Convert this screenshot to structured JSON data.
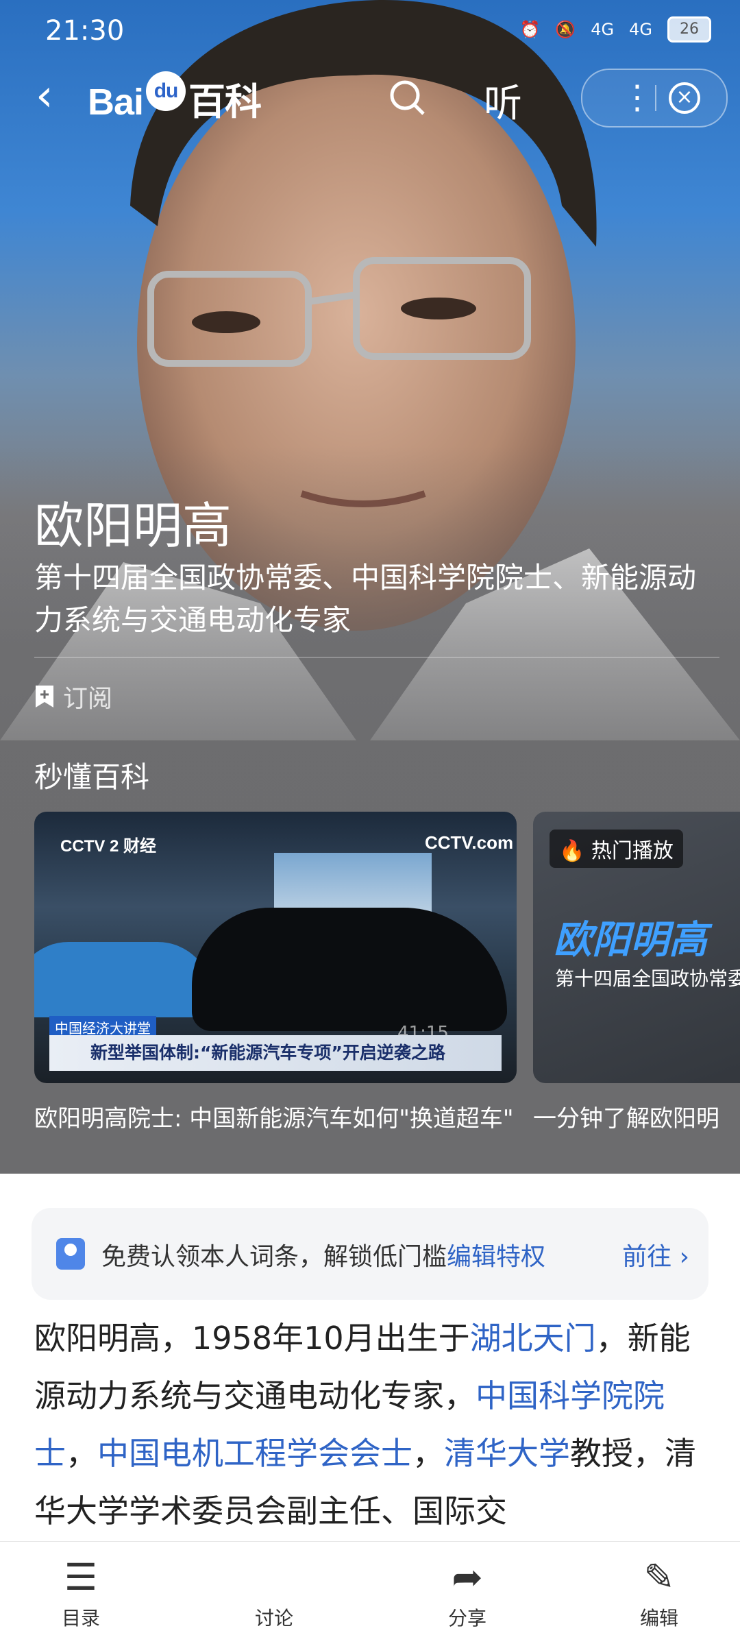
{
  "status_bar": {
    "time": "21:30",
    "signal1": "4G",
    "signal2": "4G",
    "battery": "26"
  },
  "topbar": {
    "logo_text_a": "Bai",
    "logo_text_b": "du",
    "logo_text_c": "百科",
    "listen_label": "听"
  },
  "person": {
    "name": "欧阳明高",
    "description": "第十四届全国政协常委、中国科学院院士、新能源动力系统与交通电动化专家",
    "subscribe_label": "订阅"
  },
  "video_section": {
    "title": "秒懂百科",
    "cards": [
      {
        "caption": "欧阳明高院士: 中国新能源汽车如何\"换道超车\"",
        "channel": "CCTV 2 财经",
        "channel2": "CCTV.com",
        "news_tag": "中国经济大讲堂",
        "news_headline": "新型举国体制:“新能源汽车专项”开启逆袭之路",
        "duration": "41:15"
      },
      {
        "caption": "一分钟了解欧阳明",
        "badge": "热门播放",
        "thumb_title": "欧阳明高",
        "thumb_subtitle": "第十四届全国政协常委"
      }
    ]
  },
  "claim_banner": {
    "text": "免费认领本人词条，解锁低门槛",
    "link": "编辑特权",
    "go": "前往 ›"
  },
  "article": {
    "p1": "欧阳明高，1958年10月出生于",
    "l1": "湖北天门",
    "p2": "，新能源动力系统与交通电动化专家，",
    "l2": "中国科学院院士",
    "p3": "，",
    "l3": "中国电机工程学会会士",
    "p4": "，",
    "l4": "清华大学",
    "p5": "教授，清华大学学术委员会副主任、国际交"
  },
  "bottom_nav": [
    {
      "label": "目录",
      "icon": "list-icon"
    },
    {
      "label": "讨论",
      "icon": "chat-icon"
    },
    {
      "label": "分享",
      "icon": "share-icon"
    },
    {
      "label": "编辑",
      "icon": "edit-icon"
    }
  ]
}
